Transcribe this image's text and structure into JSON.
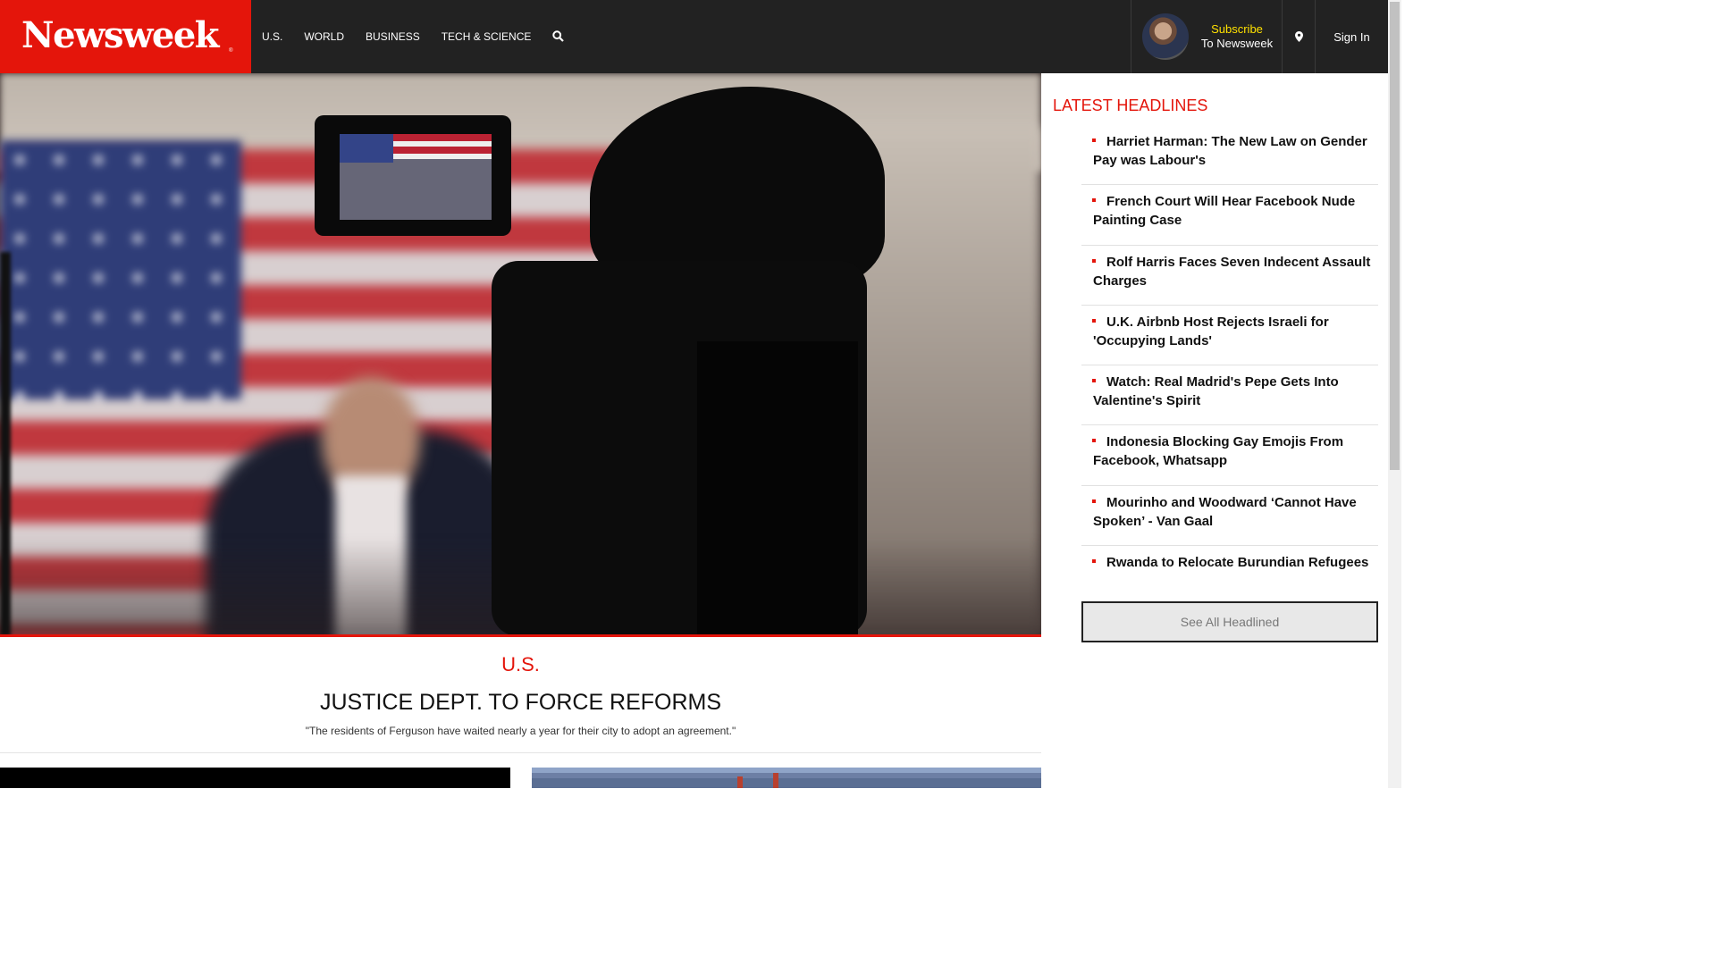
{
  "header": {
    "logo_text": "Newsweek",
    "logo_mark": "®",
    "nav_items": [
      "U.S.",
      "WORLD",
      "BUSINESS",
      "TECH & SCIENCE"
    ],
    "search_icon": "search-icon",
    "subscribe_top": "Subscribe",
    "subscribe_bottom": "To Newsweek",
    "location_icon": "map-pin-icon",
    "sign_in": "Sign In"
  },
  "hero": {
    "category": "U.S.",
    "title": "JUSTICE DEPT. TO FORCE REFORMS",
    "quote": "\"The residents of Ferguson have waited nearly a year for their city to adopt an agreement.\""
  },
  "sidebar": {
    "title": "LATEST HEADLINES",
    "headlines": [
      "Harriet Harman: The New Law on Gender Pay was Labour's",
      "French Court Will Hear Facebook Nude Painting Case",
      "Rolf Harris Faces Seven Indecent Assault Charges",
      "U.K. Airbnb Host Rejects Israeli for 'Occupying Lands'",
      "Watch: Real Madrid's Pepe Gets Into Valentine's Spirit",
      "Indonesia Blocking Gay Emojis From Facebook, Whatsapp",
      "Mourinho and Woodward ‘Cannot Have Spoken’ - Van Gaal",
      "Rwanda to Relocate Burundian Refugees"
    ],
    "see_all": "See All Headlined"
  },
  "colors": {
    "brand_red": "#e4150b",
    "header_bg": "#222222",
    "subscribe_yellow": "#ffe100"
  }
}
